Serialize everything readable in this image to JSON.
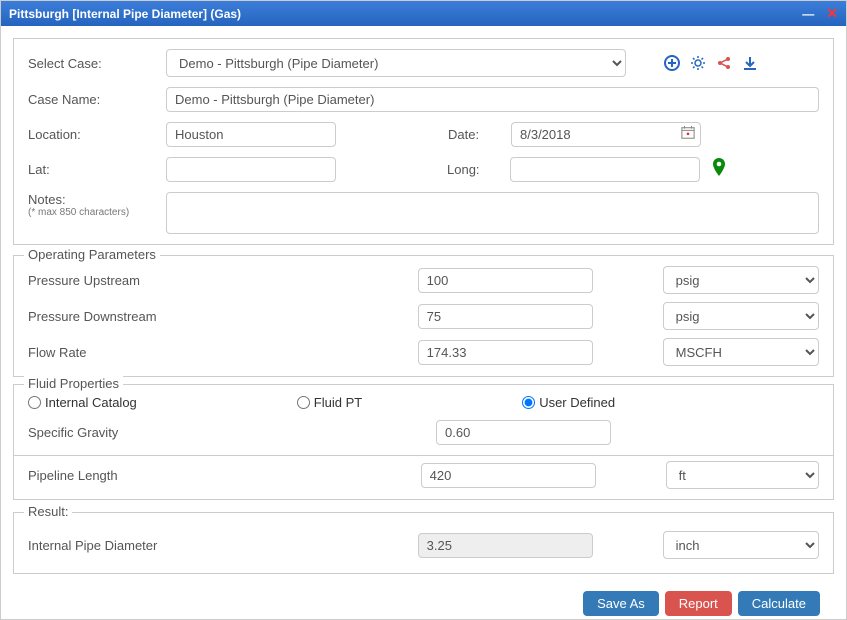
{
  "window": {
    "title": "Pittsburgh [Internal Pipe Diameter] (Gas)"
  },
  "caseRow": {
    "selectLabel": "Select Case:",
    "caseSelected": "Demo - Pittsburgh (Pipe Diameter)",
    "caseNameLabel": "Case Name:",
    "caseName": "Demo - Pittsburgh (Pipe Diameter)",
    "locationLabel": "Location:",
    "location": "Houston",
    "dateLabel": "Date:",
    "date": "8/3/2018",
    "latLabel": "Lat:",
    "lat": "",
    "longLabel": "Long:",
    "long": "",
    "notesLabel": "Notes:",
    "notesHint": "(* max 850 characters)",
    "notes": ""
  },
  "operating": {
    "legend": "Operating Parameters",
    "pressureUpLabel": "Pressure Upstream",
    "pressureUp": "100",
    "pressureUpUnit": "psig",
    "pressureDownLabel": "Pressure Downstream",
    "pressureDown": "75",
    "pressureDownUnit": "psig",
    "flowLabel": "Flow Rate",
    "flow": "174.33",
    "flowUnit": "MSCFH"
  },
  "fluid": {
    "legend": "Fluid Properties",
    "opt1": "Internal Catalog",
    "opt2": "Fluid PT",
    "opt3": "User Defined",
    "sgLabel": "Specific Gravity",
    "sg": "0.60"
  },
  "pipeline": {
    "label": "Pipeline Length",
    "value": "420",
    "unit": "ft"
  },
  "result": {
    "legend": "Result:",
    "label": "Internal Pipe Diameter",
    "value": "3.25",
    "unit": "inch"
  },
  "buttons": {
    "saveAs": "Save As",
    "report": "Report",
    "calculate": "Calculate"
  }
}
